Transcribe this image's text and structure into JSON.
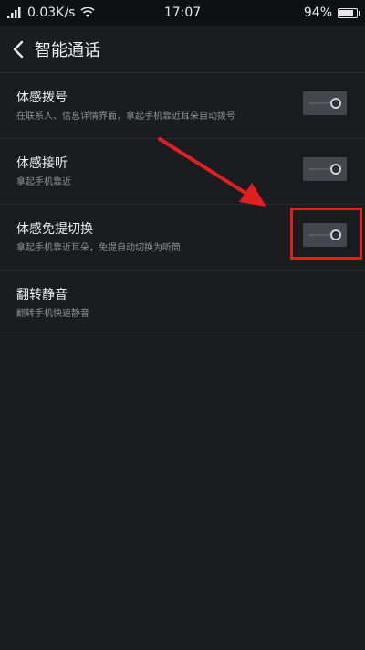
{
  "status_bar": {
    "network_speed": "0.03K/s",
    "time": "17:07",
    "battery_percent": "94%",
    "battery_level": 0.94
  },
  "header": {
    "title": "智能通话"
  },
  "settings": [
    {
      "title": "体感拨号",
      "description": "在联系人、信息详情界面，拿起手机靠近耳朵自动拨号",
      "enabled": false
    },
    {
      "title": "体感接听",
      "description": "拿起手机靠近",
      "enabled": false
    },
    {
      "title": "体感免提切换",
      "description": "拿起手机靠近耳朵，免提自动切换为听筒",
      "enabled": false,
      "highlighted": true
    },
    {
      "title": "翻转静音",
      "description": "翻转手机快速静音"
    }
  ],
  "colors": {
    "background": "#1a1c1f",
    "status_bar": "#0f1012",
    "annotation": "#e02020",
    "toggle_off": "#44484d"
  },
  "icons": {
    "back": "chevron-left-icon",
    "signal": "signal-icon",
    "wifi": "wifi-icon",
    "battery": "battery-icon"
  }
}
